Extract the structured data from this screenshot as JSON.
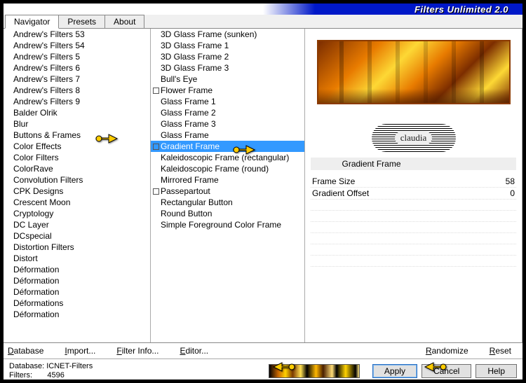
{
  "app_title": "Filters Unlimited 2.0",
  "tabs": [
    "Navigator",
    "Presets",
    "About"
  ],
  "active_tab": 0,
  "categories": [
    "Andrew's Filters 53",
    "Andrew's Filters 54",
    "Andrew's Filters 5",
    "Andrew's Filters 6",
    "Andrew's Filters 7",
    "Andrew's Filters 8",
    "Andrew's Filters 9",
    "Balder Olrik",
    "Blur",
    "Buttons & Frames",
    "Color Effects",
    "Color Filters",
    "ColorRave",
    "Convolution Filters",
    "CPK Designs",
    "Crescent Moon",
    "Cryptology",
    "DC Layer",
    "DCspecial",
    "Distortion Filters",
    "Distort",
    "Déformation",
    "Déformation",
    "Déformation",
    "Déformations",
    "Déformation"
  ],
  "selected_category_index": 9,
  "filters": [
    {
      "label": "3D Glass Frame (sunken)",
      "exp": false
    },
    {
      "label": "3D Glass Frame 1",
      "exp": false
    },
    {
      "label": "3D Glass Frame 2",
      "exp": false
    },
    {
      "label": "3D Glass Frame 3",
      "exp": false
    },
    {
      "label": "Bull's Eye",
      "exp": false
    },
    {
      "label": "Flower Frame",
      "exp": true
    },
    {
      "label": "Glass Frame 1",
      "exp": false
    },
    {
      "label": "Glass Frame 2",
      "exp": false
    },
    {
      "label": "Glass Frame 3",
      "exp": false
    },
    {
      "label": "Glass Frame",
      "exp": false
    },
    {
      "label": "Gradient Frame",
      "exp": true
    },
    {
      "label": "Kaleidoscopic Frame (rectangular)",
      "exp": false
    },
    {
      "label": "Kaleidoscopic Frame (round)",
      "exp": false
    },
    {
      "label": "Mirrored Frame",
      "exp": false
    },
    {
      "label": "Passepartout",
      "exp": true
    },
    {
      "label": "Rectangular Button",
      "exp": false
    },
    {
      "label": "Round Button",
      "exp": false
    },
    {
      "label": "Simple Foreground Color Frame",
      "exp": false
    }
  ],
  "selected_filter_index": 10,
  "watermark_text": "claudia",
  "selected_filter_title": "Gradient Frame",
  "params": [
    {
      "name": "Frame Size",
      "value": "58"
    },
    {
      "name": "Gradient Offset",
      "value": "0"
    }
  ],
  "toolbar": {
    "database": "Database",
    "import": "Import...",
    "filter_info": "Filter Info...",
    "editor": "Editor...",
    "randomize": "Randomize",
    "reset": "Reset"
  },
  "footer": {
    "db_label": "Database:",
    "db_value": "ICNET-Filters",
    "filters_label": "Filters:",
    "filters_value": "4596",
    "apply": "Apply",
    "cancel": "Cancel",
    "help": "Help"
  }
}
